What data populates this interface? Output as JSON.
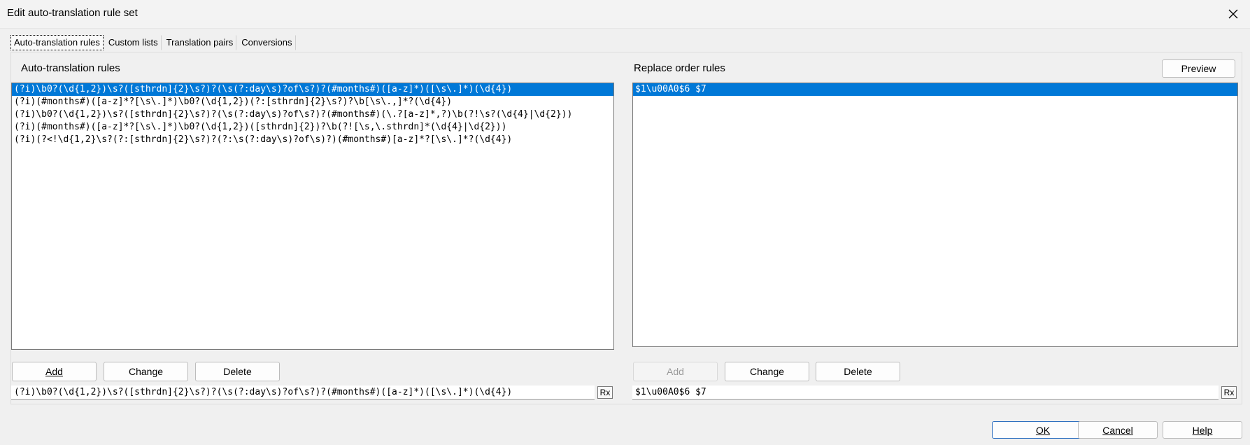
{
  "window": {
    "title": "Edit auto-translation rule set"
  },
  "tabs": [
    {
      "label": "Auto-translation rules",
      "active": true
    },
    {
      "label": "Custom lists",
      "active": false
    },
    {
      "label": "Translation pairs",
      "active": false
    },
    {
      "label": "Conversions",
      "active": false
    }
  ],
  "left": {
    "label": "Auto-translation rules",
    "rules": [
      "(?i)\\b0?(\\d{1,2})\\s?([sthrdn]{2}\\s?)?(\\s(?:day\\s)?of\\s?)?(#months#)([a-z]*)([\\s\\.]*)(\\d{4})",
      "(?i)(#months#)([a-z]*?[\\s\\.]*)\\b0?(\\d{1,2})(?:[sthrdn]{2}\\s?)?\\b[\\s\\.,]*?(\\d{4})",
      "(?i)\\b0?(\\d{1,2})\\s?([sthrdn]{2}\\s?)?(\\s(?:day\\s)?of\\s?)?(#months#)(\\.?[a-z]*,?)\\b(?!\\s?(\\d{4}|\\d{2}))",
      "(?i)(#months#)([a-z]*?[\\s\\.]*)\\b0?(\\d{1,2})([sthrdn]{2})?\\b(?![\\s,\\.sthrdn]*(\\d{4}|\\d{2}))",
      "(?i)(?<!\\d{1,2}\\s?(?:[sthrdn]{2}\\s?)?(?:\\s(?:day\\s)?of\\s)?)(#months#)[a-z]*?[\\s\\.]*?(\\d{4})"
    ],
    "add_label": "Add",
    "change_label": "Change",
    "delete_label": "Delete",
    "edit_value": "(?i)\\b0?(\\d{1,2})\\s?([sthrdn]{2}\\s?)?(\\s(?:day\\s)?of\\s?)?(#months#)([a-z]*)([\\s\\.]*)(\\d{4})",
    "rx_label": "Rx"
  },
  "right": {
    "label": "Replace order rules",
    "preview_label": "Preview",
    "rules": [
      "$1\\u00A0$6 $7"
    ],
    "add_label": "Add",
    "change_label": "Change",
    "delete_label": "Delete",
    "edit_value": "$1\\u00A0$6 $7",
    "rx_label": "Rx"
  },
  "footer": {
    "ok_label": "OK",
    "cancel_label": "Cancel",
    "help_label": "Help"
  },
  "colors": {
    "selection": "#0078d7",
    "default_border": "#2c6ebf"
  },
  "icons": {
    "close": "close-icon"
  }
}
